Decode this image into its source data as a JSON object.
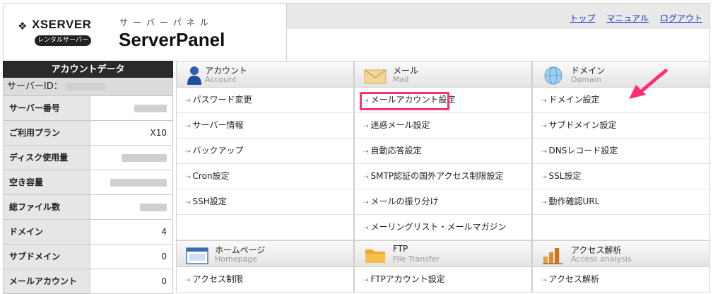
{
  "header": {
    "logo_mark": "❖",
    "brand": "XSERVER",
    "rental_badge": "レンタルサーバー",
    "kana": "サーバーパネル",
    "title": "ServerPanel",
    "nav": [
      "トップ",
      "マニュアル",
      "ログアウト"
    ]
  },
  "account_panel": {
    "title": "アカウントデータ",
    "server_id_label": "サーバーID：",
    "rows": [
      {
        "label": "サーバー番号",
        "value": ""
      },
      {
        "label": "ご利用プラン",
        "value": "X10"
      },
      {
        "label": "ディスク使用量",
        "value": ""
      },
      {
        "label": "空き容量",
        "value": ""
      },
      {
        "label": "総ファイル数",
        "value": ""
      },
      {
        "label": "ドメイン",
        "value": "4"
      },
      {
        "label": "サブドメイン",
        "value": "0"
      },
      {
        "label": "メールアカウント",
        "value": "0"
      }
    ]
  },
  "sections": {
    "account": {
      "jp": "アカウント",
      "en": "Account",
      "icon": "user-icon",
      "items": [
        "パスワード変更",
        "サーバー情報",
        "バックアップ",
        "Cron設定",
        "SSH設定"
      ]
    },
    "mail": {
      "jp": "メール",
      "en": "Mail",
      "icon": "envelope-icon",
      "items": [
        "メールアカウント設定",
        "迷惑メール設定",
        "自動応答設定",
        "SMTP認証の国外アクセス制限設定",
        "メールの振り分け",
        "メーリングリスト・メールマガジン"
      ]
    },
    "domain": {
      "jp": "ドメイン",
      "en": "Domain",
      "icon": "globe-icon",
      "items": [
        "ドメイン設定",
        "サブドメイン設定",
        "DNSレコード設定",
        "SSL設定",
        "動作確認URL"
      ]
    },
    "homepage": {
      "jp": "ホームページ",
      "en": "Homepage",
      "icon": "browser-window-icon",
      "items": [
        "アクセス制限"
      ]
    },
    "ftp": {
      "jp": "FTP",
      "en": "File Transfer",
      "icon": "folder-icon",
      "items": [
        "FTPアカウント設定"
      ]
    },
    "analytics": {
      "jp": "アクセス解析",
      "en": "Access analysis",
      "icon": "bar-chart-icon",
      "items": [
        "アクセス解析"
      ]
    }
  },
  "colors": {
    "highlight": "#ff2d7a",
    "link": "#1a33cc",
    "panel_header": "#2a2a2a"
  }
}
